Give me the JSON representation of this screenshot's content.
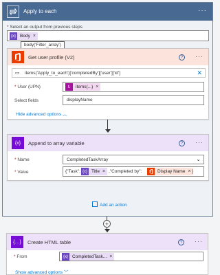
{
  "loop": {
    "title": "Apply to each",
    "select_label": "Select an output from previous steps",
    "select_required": "*",
    "body_token": "Body",
    "tooltip": "body('Filter_array')",
    "add_action_label": "Add an action"
  },
  "get_user": {
    "title": "Get user profile (V2)",
    "expression_text": "items('Apply_to_each')['completedBy']['user']['id']",
    "user_label": "User (UPN)",
    "user_token": "items(...)",
    "select_fields_label": "Select fields",
    "select_fields_value": "displayName",
    "hide_advanced": "Hide advanced options"
  },
  "append": {
    "title": "Append to array variable",
    "name_label": "Name",
    "name_value": "CompletedTaskArray",
    "value_label": "Value",
    "value_prefix": "{\"Task\":",
    "title_token": "Title",
    "value_mid": ",\"Completed by\":",
    "display_token": "Display Name",
    "value_suffix": "}"
  },
  "html_table": {
    "title": "Create HTML table",
    "from_label": "From",
    "from_token": "CompletedTask...",
    "show_advanced": "Show advanced options"
  },
  "colors": {
    "loop_header": "#486991",
    "office_orange": "#eb3c00",
    "variable_purple": "#770bd6",
    "token_purple": "#a4129e"
  }
}
